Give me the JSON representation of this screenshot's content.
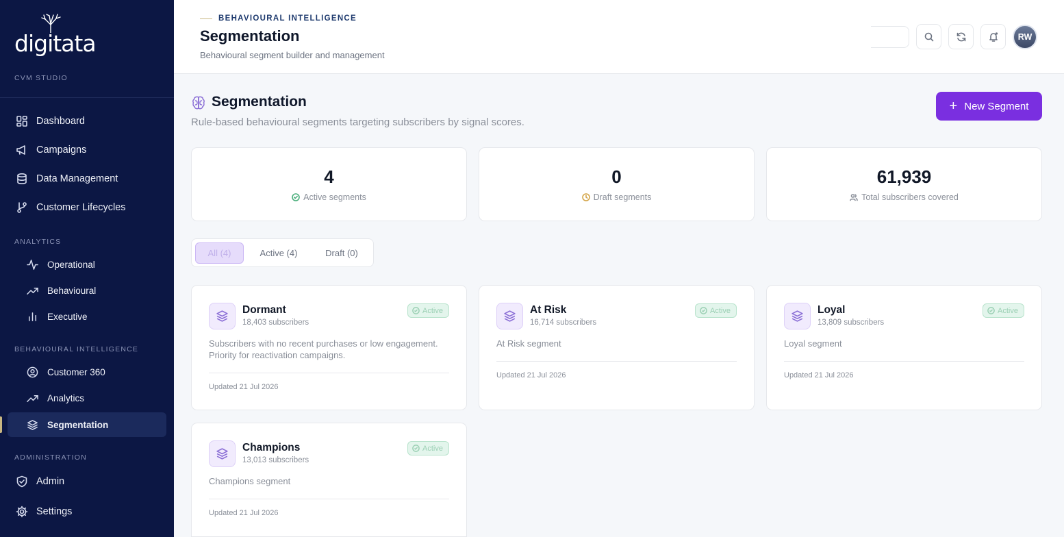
{
  "brand": {
    "logo_text": "digitata",
    "studio_label": "CVM STUDIO"
  },
  "sidebar": {
    "main_items": [
      {
        "label": "Dashboard",
        "icon": "dashboard-icon"
      },
      {
        "label": "Campaigns",
        "icon": "megaphone-icon"
      },
      {
        "label": "Data Management",
        "icon": "database-icon"
      },
      {
        "label": "Customer Lifecycles",
        "icon": "git-branch-icon"
      }
    ],
    "analytics_label": "ANALYTICS",
    "analytics_items": [
      {
        "label": "Operational",
        "icon": "activity-icon"
      },
      {
        "label": "Behavioural",
        "icon": "trending-up-icon"
      },
      {
        "label": "Executive",
        "icon": "bar-chart-icon"
      }
    ],
    "bi_label": "BEHAVIOURAL INTELLIGENCE",
    "bi_items": [
      {
        "label": "Customer 360",
        "icon": "user-circle-icon"
      },
      {
        "label": "Analytics",
        "icon": "trending-up-icon"
      },
      {
        "label": "Segmentation",
        "icon": "layers-icon",
        "active": true
      }
    ],
    "admin_label": "ADMINISTRATION",
    "admin_items": [
      {
        "label": "Admin",
        "icon": "shield-icon"
      },
      {
        "label": "Settings",
        "icon": "gear-icon"
      }
    ]
  },
  "header": {
    "eyebrow": "BEHAVIOURAL INTELLIGENCE",
    "title": "Segmentation",
    "subtitle": "Behavioural segment builder and management",
    "avatar_initials": "RW"
  },
  "main": {
    "title": "Segmentation",
    "subtitle": "Rule-based behavioural segments targeting subscribers by signal scores.",
    "new_button_label": "New Segment",
    "stats": [
      {
        "value": "4",
        "label": "Active segments",
        "icon": "check-circle-icon"
      },
      {
        "value": "0",
        "label": "Draft segments",
        "icon": "clock-icon"
      },
      {
        "value": "61,939",
        "label": "Total subscribers covered",
        "icon": "users-icon"
      }
    ],
    "tabs": [
      {
        "label": "All (4)",
        "selected": true
      },
      {
        "label": "Active (4)"
      },
      {
        "label": "Draft (0)"
      }
    ],
    "segments": [
      {
        "name": "Dormant",
        "subscribers": "18,403 subscribers",
        "status": "Active",
        "description": "Subscribers with no recent purchases or low engagement. Priority for reactivation campaigns.",
        "updated": "Updated 21 Jul 2026"
      },
      {
        "name": "At Risk",
        "subscribers": "16,714 subscribers",
        "status": "Active",
        "description": "At Risk segment",
        "updated": "Updated 21 Jul 2026"
      },
      {
        "name": "Loyal",
        "subscribers": "13,809 subscribers",
        "status": "Active",
        "description": "Loyal segment",
        "updated": "Updated 21 Jul 2026"
      },
      {
        "name": "Champions",
        "subscribers": "13,013 subscribers",
        "status": "Active",
        "description": "Champions segment",
        "updated": "Updated 21 Jul 2026"
      }
    ]
  },
  "colors": {
    "sidebar_bg": "#0c1744",
    "accent": "#7a2fe0",
    "active_badge": "#e3f5ec"
  }
}
